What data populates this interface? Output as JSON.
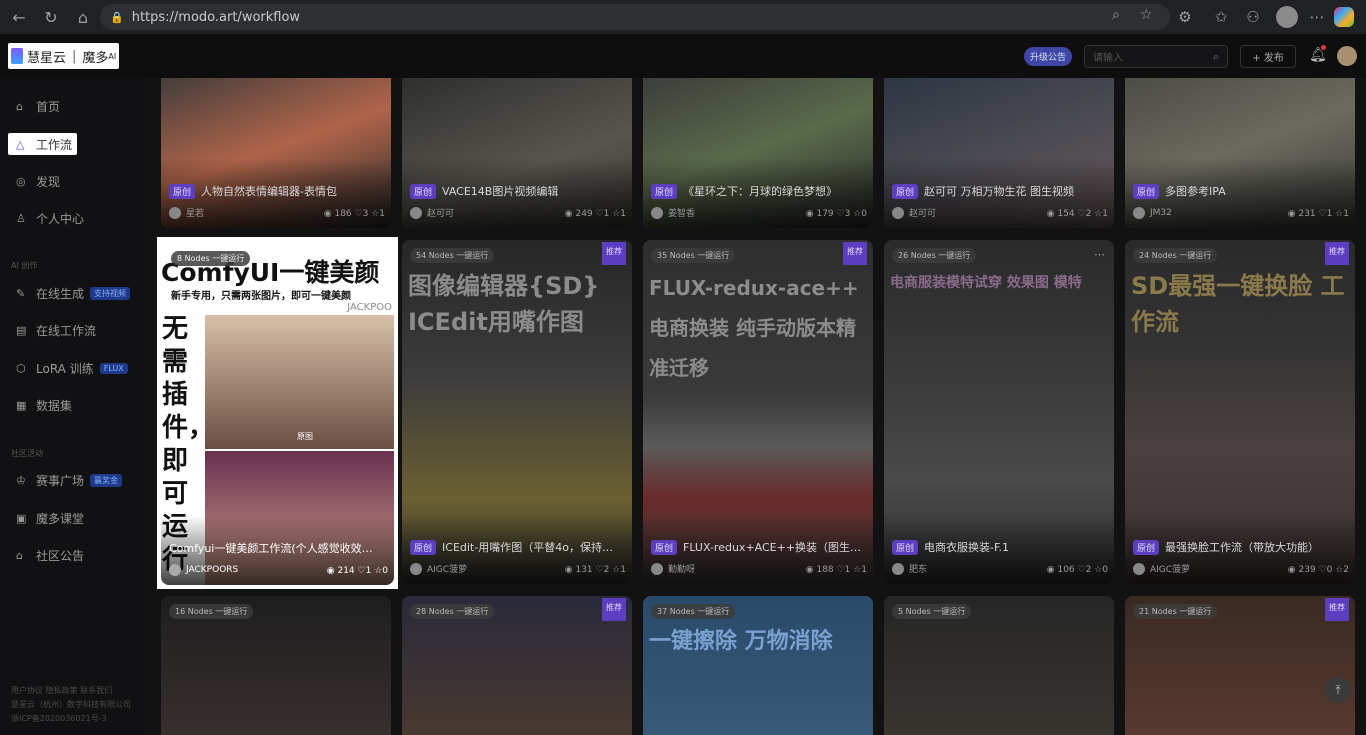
{
  "browser": {
    "url": "https://modo.art/workflow"
  },
  "header": {
    "logo_cn": "慧星云",
    "logo_product": "魔多",
    "logo_sup": "AI",
    "upgrade_label": "升级公告",
    "search_placeholder": "请输入",
    "publish_label": "+ 发布"
  },
  "sidebar": {
    "items": [
      {
        "label": "首页",
        "icon": "home-icon"
      },
      {
        "label": "工作流",
        "icon": "workflow-icon"
      },
      {
        "label": "发现",
        "icon": "discover-icon"
      },
      {
        "label": "个人中心",
        "icon": "user-icon"
      }
    ],
    "section_ai": "AI 创作",
    "ai_items": [
      {
        "label": "在线生成",
        "tag": "支持视频"
      },
      {
        "label": "在线工作流",
        "tag": ""
      },
      {
        "label": "LoRA 训练",
        "tag": "FLUX"
      },
      {
        "label": "数据集",
        "tag": ""
      }
    ],
    "section_community": "社区活动",
    "community_items": [
      {
        "label": "赛事广场",
        "tag": "赢奖金"
      },
      {
        "label": "魔多课堂",
        "tag": ""
      },
      {
        "label": "社区公告",
        "tag": ""
      }
    ],
    "footer_links": "用户协议  隐私政策  联系我们",
    "footer_company": "慧星云（杭州）数字科技有限公司",
    "footer_icp": "浙ICP备2020036021号-3"
  },
  "cards_row1": [
    {
      "title": "人物自然表情编辑器-表情包",
      "author": "星若",
      "views": "186",
      "likes": "3",
      "stars": "1"
    },
    {
      "title": "VACE14B图片视频编辑",
      "author": "赵可可",
      "views": "249",
      "likes": "1",
      "stars": "1"
    },
    {
      "title": "《星环之下：月球的绿色梦想》",
      "author": "姜智香",
      "views": "179",
      "likes": "3",
      "stars": "0"
    },
    {
      "title": "赵可可 万相万物生花 图生视频",
      "author": "赵可可",
      "views": "154",
      "likes": "2",
      "stars": "1"
    },
    {
      "title": "多图参考IPA",
      "author": "JM32",
      "views": "231",
      "likes": "1",
      "stars": "1"
    }
  ],
  "cards_row2": [
    {
      "nodes": "8 Nodes  一键运行",
      "title": "Comfyui一键美颜工作流(个人感觉收效…",
      "author": "JACKPOORS",
      "views": "214",
      "likes": "1",
      "stars": "0",
      "headline": "ComfyUI一键美颜",
      "sub": "新手专用，只需两张图片，即可一键美颜",
      "brand": "JACKPOO",
      "vert": "无需插件，即可运行",
      "photo_label": "原图"
    },
    {
      "nodes": "54 Nodes  一键运行",
      "title": "ICEdit-用嘴作图（平替4o，保持…",
      "author": "AIGC菠萝",
      "views": "131",
      "likes": "2",
      "stars": "1",
      "big": "图像编辑器{SD} ICEdit用嘴作图",
      "rec": "推荐"
    },
    {
      "nodes": "35 Nodes  一键运行",
      "title": "FLUX-redux+ACE++换装（图生…",
      "author": "勤勤呀",
      "views": "188",
      "likes": "1",
      "stars": "1",
      "big": "FLUX-redux-ace++ 电商换装 纯手动版本精准迁移",
      "rec": "推荐"
    },
    {
      "nodes": "26 Nodes  一键运行",
      "title": "电商衣服换装-F.1",
      "author": "肥东",
      "views": "106",
      "likes": "2",
      "stars": "0",
      "big": "电商服装模特试穿 效果图 模特"
    },
    {
      "nodes": "24 Nodes  一键运行",
      "title": "最强换脸工作流（带放大功能）",
      "author": "AIGC菠萝",
      "views": "239",
      "likes": "0",
      "stars": "2",
      "big": "SD最强一键换脸 工作流",
      "rec": "推荐"
    }
  ],
  "cards_row3": [
    {
      "nodes": "16 Nodes  一键运行"
    },
    {
      "nodes": "28 Nodes  一键运行",
      "rec": "推荐"
    },
    {
      "nodes": "37 Nodes  一键运行",
      "big": "一键擦除 万物消除"
    },
    {
      "nodes": "5 Nodes  一键运行"
    },
    {
      "nodes": "21 Nodes  一键运行",
      "rec": "推荐"
    }
  ],
  "badge_original": "原创",
  "colors": {
    "accent": "#5b3fc0",
    "highlight": "#ffffff"
  }
}
